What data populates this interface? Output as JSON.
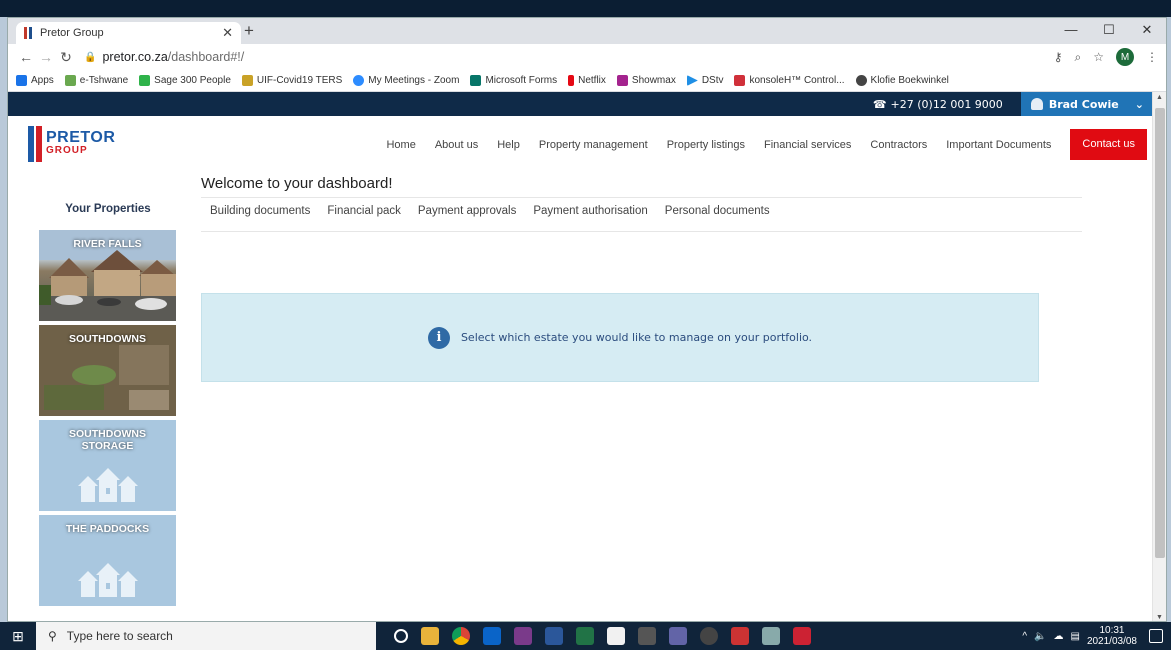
{
  "browser": {
    "tab_title": "Pretor Group",
    "url_host": "pretor.co.za",
    "url_path": "/dashboard#!/",
    "profile_initial": "M",
    "bookmarks": [
      {
        "label": "Apps",
        "color": "#1a73e8"
      },
      {
        "label": "e-Tshwane",
        "color": "#6aa84f"
      },
      {
        "label": "Sage 300 People",
        "color": "#2fb34a"
      },
      {
        "label": "UIF-Covid19 TERS",
        "color": "#c9a227"
      },
      {
        "label": "My Meetings - Zoom",
        "color": "#2d8cff"
      },
      {
        "label": "Microsoft Forms",
        "color": "#077568"
      },
      {
        "label": "Netflix",
        "color": "#e50914"
      },
      {
        "label": "Showmax",
        "color": "#a4238e"
      },
      {
        "label": "DStv",
        "color": "#1f8fe5"
      },
      {
        "label": "konsoleH™ Control...",
        "color": "#d0303a"
      },
      {
        "label": "Klofie Boekwinkel",
        "color": "#444444"
      }
    ]
  },
  "site": {
    "phone": "+27 (0)12 001 9000",
    "user_name": "Brad Cowie",
    "logo": {
      "line1": "PRETOR",
      "line2": "GROUP"
    },
    "nav": [
      "Home",
      "About us",
      "Help",
      "Property management",
      "Property listings",
      "Financial services",
      "Contractors",
      "Important Documents"
    ],
    "contact_label": "Contact us",
    "welcome_title": "Welcome to your dashboard!",
    "subnav": [
      "Building documents",
      "Financial pack",
      "Payment approvals",
      "Payment authorisation",
      "Personal documents"
    ],
    "properties_heading": "Your Properties",
    "properties": [
      "RIVER FALLS",
      "SOUTHDOWNS",
      "SOUTHDOWNS STORAGE",
      "THE PADDOCKS"
    ],
    "info_message": "Select which estate you would like to manage on your portfolio.",
    "colors": {
      "navy": "#0f2a48",
      "accent_blue": "#2074b6",
      "contact_red": "#e00b12",
      "info_bg": "#d6ecf3"
    }
  },
  "taskbar": {
    "search_placeholder": "Type here to search",
    "time": "10:31",
    "date": "2021/03/08"
  }
}
